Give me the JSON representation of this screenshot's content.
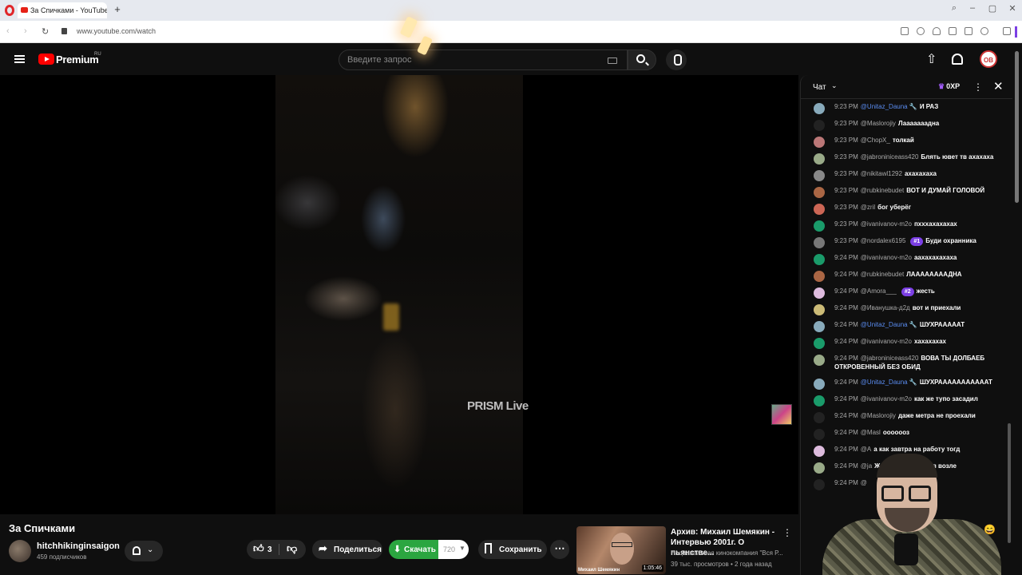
{
  "browser": {
    "tab_title": "За Спичками - YouTube",
    "url": "www.youtube.com/watch"
  },
  "header": {
    "logo_text": "Premium",
    "region": "RU",
    "search_placeholder": "Введите запрос",
    "avatar_initials": "ОВ"
  },
  "video": {
    "watermark": "PRISM Live",
    "title": "За Спичками",
    "channel_name": "hitchhikinginsaigon",
    "subscribers": "459 подписчиков",
    "likes": "3",
    "share_label": "Поделиться",
    "download_label": "Скачать",
    "quality": "720",
    "save_label": "Сохранить"
  },
  "recommendation": {
    "title": "Архив: Михаил Шемякин - Интервью 2001г. О пьянстве...",
    "channel": "Национальная кинокомпания \"Вся Р...",
    "meta": "39 тыс. просмотров • 2 года назад",
    "thumb_caption": "Михаил Шемякин",
    "duration": "1:05:46"
  },
  "chat": {
    "title": "Чат",
    "points": "0XP",
    "messages": [
      {
        "time": "9:23 PM",
        "author": "@Unitaz_Dauna 🔧",
        "text": "И РАЗ",
        "author_blue": true,
        "avatar": "#8ab"
      },
      {
        "time": "9:23 PM",
        "author": "@Maslorojiy",
        "text": "Лааааааадна",
        "author_blue": false,
        "avatar": "#222"
      },
      {
        "time": "9:23 PM",
        "author": "@ChopX_",
        "text": "толкай",
        "author_blue": false,
        "avatar": "#b77"
      },
      {
        "time": "9:23 PM",
        "author": "@jabroniniceass420",
        "text": "Блять ювет тв ахахаха",
        "author_blue": false,
        "avatar": "#9a8"
      },
      {
        "time": "9:23 PM",
        "author": "@nikitawl1292",
        "text": "ахахахаха",
        "author_blue": false,
        "avatar": "#888"
      },
      {
        "time": "9:23 PM",
        "author": "@rubkinebudet",
        "text": "ВОТ И ДУМАЙ ГОЛОВОЙ",
        "author_blue": false,
        "avatar": "#a64"
      },
      {
        "time": "9:23 PM",
        "author": "@zril",
        "text": "бог уберёг",
        "author_blue": false,
        "avatar": "#c65"
      },
      {
        "time": "9:23 PM",
        "author": "@ivanivanov-m2o",
        "text": "пхххахахахах",
        "author_blue": false,
        "avatar": "#1a9b6a"
      },
      {
        "time": "9:23 PM",
        "author": "@nordalex6195",
        "badge": "#1",
        "text": "Буди охранника",
        "author_blue": false,
        "avatar": "#777"
      },
      {
        "time": "9:24 PM",
        "author": "@ivanivanov-m2o",
        "text": "аахахахахаха",
        "author_blue": false,
        "avatar": "#1a9b6a"
      },
      {
        "time": "9:24 PM",
        "author": "@rubkinebudet",
        "text": "ЛААААААААДНА",
        "author_blue": false,
        "avatar": "#a64"
      },
      {
        "time": "9:24 PM",
        "author": "@Amora___",
        "badge": "#2",
        "text": "жесть",
        "author_blue": false,
        "avatar": "#dbd"
      },
      {
        "time": "9:24 PM",
        "author": "@Иванушка-д2д",
        "text": "вот и приехали",
        "author_blue": false,
        "avatar": "#cb7"
      },
      {
        "time": "9:24 PM",
        "author": "@Unitaz_Dauna 🔧",
        "text": "ШУХРАААААТ",
        "author_blue": true,
        "avatar": "#8ab"
      },
      {
        "time": "9:24 PM",
        "author": "@ivanivanov-m2o",
        "text": "хахахахах",
        "author_blue": false,
        "avatar": "#1a9b6a"
      },
      {
        "time": "9:24 PM",
        "author": "@jabroniniceass420",
        "text": "ВОВА ТЫ ДОЛБАЕБ ОТКРОВЕННЫЙ БЕЗ ОБИД",
        "author_blue": false,
        "avatar": "#9a8"
      },
      {
        "time": "9:24 PM",
        "author": "@Unitaz_Dauna 🔧",
        "text": "ШУХРАААААААААААТ",
        "author_blue": true,
        "avatar": "#8ab"
      },
      {
        "time": "9:24 PM",
        "author": "@ivanivanov-m2o",
        "text": "как же тупо засадил",
        "author_blue": false,
        "avatar": "#1a9b6a"
      },
      {
        "time": "9:24 PM",
        "author": "@Maslorojiy",
        "text": "даже метра не проехали",
        "author_blue": false,
        "avatar": "#222"
      },
      {
        "time": "9:24 PM",
        "author": "@Masl",
        "text": "ооооооз",
        "author_blue": false,
        "avatar": "#222"
      },
      {
        "time": "9:24 PM",
        "author": "@A",
        "text": "а как завтра на работу тогд",
        "author_blue": false,
        "avatar": "#dbd"
      },
      {
        "time": "9:24 PM",
        "author": "@ja",
        "text": "Ждем переворот тв возле",
        "author_blue": false,
        "avatar": "#9a8"
      },
      {
        "time": "9:24 PM",
        "author": "@",
        "text": "",
        "author_blue": false,
        "avatar": "#222"
      }
    ]
  }
}
